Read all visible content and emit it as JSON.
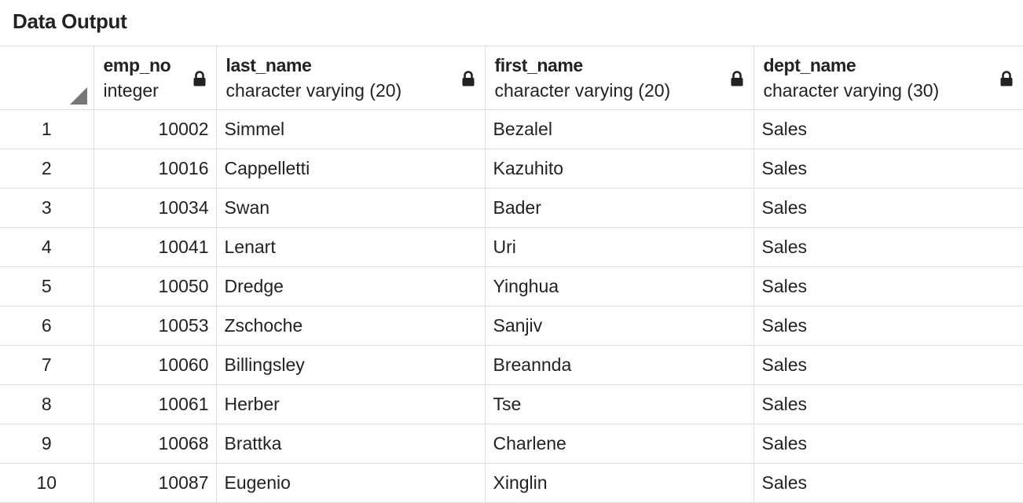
{
  "panel": {
    "title": "Data Output"
  },
  "columns": [
    {
      "name": "emp_no",
      "type": "integer",
      "lock_icon": "lock-icon"
    },
    {
      "name": "last_name",
      "type": "character varying (20)",
      "lock_icon": "lock-icon"
    },
    {
      "name": "first_name",
      "type": "character varying (20)",
      "lock_icon": "lock-icon"
    },
    {
      "name": "dept_name",
      "type": "character varying (30)",
      "lock_icon": "lock-icon"
    }
  ],
  "rows": [
    {
      "row_number": "1",
      "emp_no": "10002",
      "last_name": "Simmel",
      "first_name": "Bezalel",
      "dept_name": "Sales"
    },
    {
      "row_number": "2",
      "emp_no": "10016",
      "last_name": "Cappelletti",
      "first_name": "Kazuhito",
      "dept_name": "Sales"
    },
    {
      "row_number": "3",
      "emp_no": "10034",
      "last_name": "Swan",
      "first_name": "Bader",
      "dept_name": "Sales"
    },
    {
      "row_number": "4",
      "emp_no": "10041",
      "last_name": "Lenart",
      "first_name": "Uri",
      "dept_name": "Sales"
    },
    {
      "row_number": "5",
      "emp_no": "10050",
      "last_name": "Dredge",
      "first_name": "Yinghua",
      "dept_name": "Sales"
    },
    {
      "row_number": "6",
      "emp_no": "10053",
      "last_name": "Zschoche",
      "first_name": "Sanjiv",
      "dept_name": "Sales"
    },
    {
      "row_number": "7",
      "emp_no": "10060",
      "last_name": "Billingsley",
      "first_name": "Breannda",
      "dept_name": "Sales"
    },
    {
      "row_number": "8",
      "emp_no": "10061",
      "last_name": "Herber",
      "first_name": "Tse",
      "dept_name": "Sales"
    },
    {
      "row_number": "9",
      "emp_no": "10068",
      "last_name": "Brattka",
      "first_name": "Charlene",
      "dept_name": "Sales"
    },
    {
      "row_number": "10",
      "emp_no": "10087",
      "last_name": "Eugenio",
      "first_name": "Xinglin",
      "dept_name": "Sales"
    }
  ]
}
